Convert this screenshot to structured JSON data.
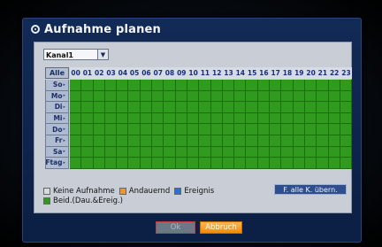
{
  "dialog": {
    "title": "Aufnahme planen",
    "channel": {
      "value": "Kanal1"
    },
    "grid": {
      "all_label": "Alle",
      "hours": [
        "00",
        "01",
        "02",
        "03",
        "04",
        "05",
        "06",
        "07",
        "08",
        "09",
        "10",
        "11",
        "12",
        "13",
        "14",
        "15",
        "16",
        "17",
        "18",
        "19",
        "20",
        "21",
        "22",
        "23"
      ],
      "days": [
        "So",
        "Mo",
        "Di",
        "Mi",
        "Do",
        "Fr",
        "Sa",
        "Ftag"
      ],
      "fill_mode": "Beid.(Dau.&Ereig.)"
    },
    "legend": [
      {
        "label": "Keine Aufnahme",
        "color": "#d9d9d9"
      },
      {
        "label": "Andauernd",
        "color": "#e9963a"
      },
      {
        "label": "Ereignis",
        "color": "#2f6fd0"
      },
      {
        "label": "Beid.(Dau.&Ereig.)",
        "color": "#2f9a1e"
      }
    ],
    "copy_button": "F. alle K. übern.",
    "ok_button": "Ok",
    "cancel_button": "Abbruch"
  },
  "colors": {
    "accent_green": "#2f9a1e",
    "dialog_blue": "#122a56",
    "cancel_orange": "#f28a0a"
  }
}
